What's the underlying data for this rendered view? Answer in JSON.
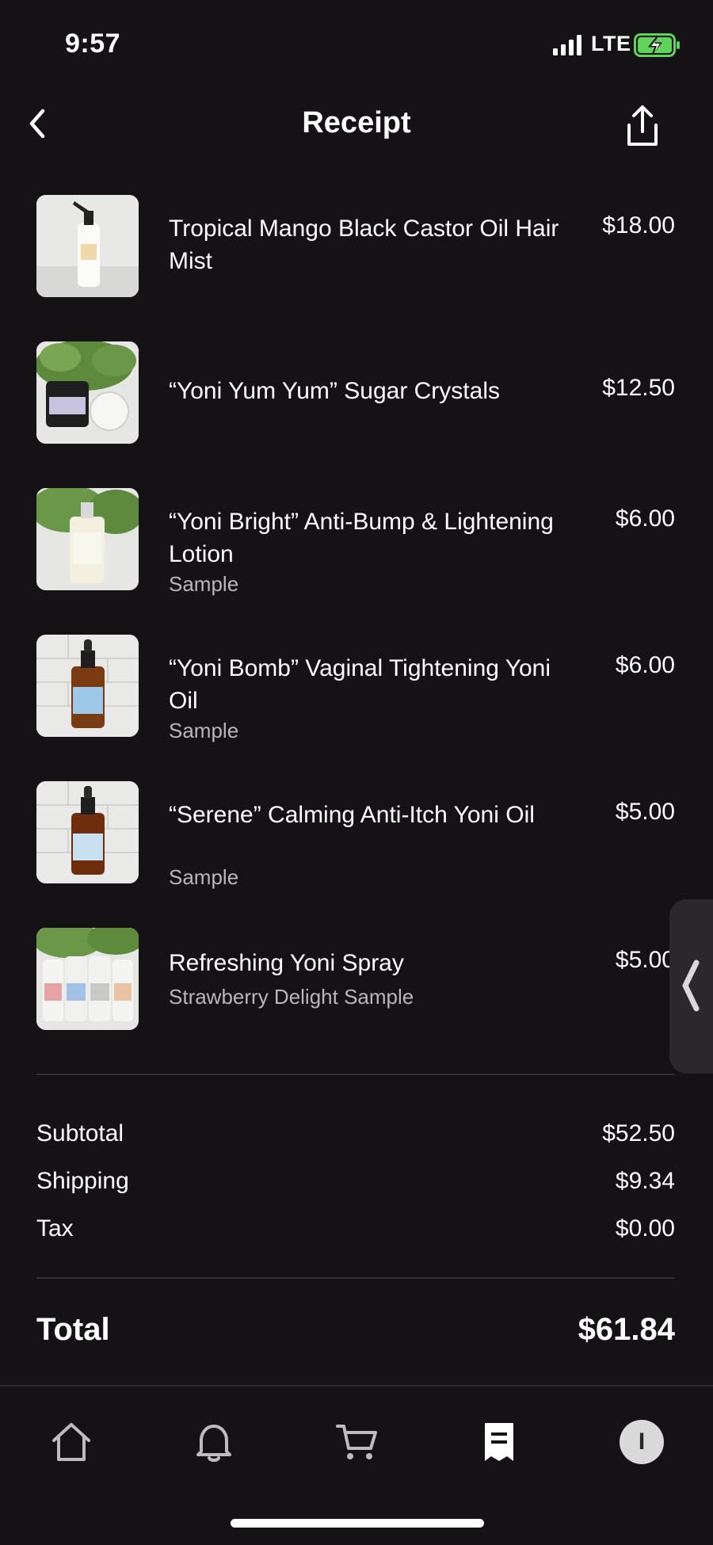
{
  "status_bar": {
    "time": "9:57",
    "carrier": "LTE"
  },
  "header": {
    "title": "Receipt"
  },
  "items": [
    {
      "name": "Tropical Mango Black Castor Oil Hair Mist",
      "sub": "",
      "price": "$18.00"
    },
    {
      "name": "“Yoni Yum Yum” Sugar Crystals",
      "sub": "",
      "price": "$12.50"
    },
    {
      "name": "“Yoni Bright” Anti-Bump & Lightening Lotion",
      "sub": "Sample",
      "price": "$6.00"
    },
    {
      "name": "“Yoni Bomb” Vaginal Tightening Yoni Oil",
      "sub": "Sample",
      "price": "$6.00"
    },
    {
      "name": "“Serene” Calming Anti-Itch Yoni Oil",
      "sub": "Sample",
      "price": "$5.00"
    },
    {
      "name": "Refreshing Yoni Spray",
      "sub": "Strawberry Delight Sample",
      "price": "$5.00"
    }
  ],
  "summary": {
    "subtotal_label": "Subtotal",
    "subtotal_value": "$52.50",
    "shipping_label": "Shipping",
    "shipping_value": "$9.34",
    "tax_label": "Tax",
    "tax_value": "$0.00",
    "total_label": "Total",
    "total_value": "$61.84"
  },
  "tabbar": {
    "tabs": [
      {
        "icon": "home-icon"
      },
      {
        "icon": "bell-icon"
      },
      {
        "icon": "cart-icon"
      },
      {
        "icon": "receipt-icon",
        "active": true
      },
      {
        "icon": "avatar",
        "initial": "I"
      }
    ]
  },
  "colors": {
    "background": "#141214",
    "text": "#ffffff",
    "secondary_text": "#b8b6b8",
    "divider": "#333033"
  }
}
